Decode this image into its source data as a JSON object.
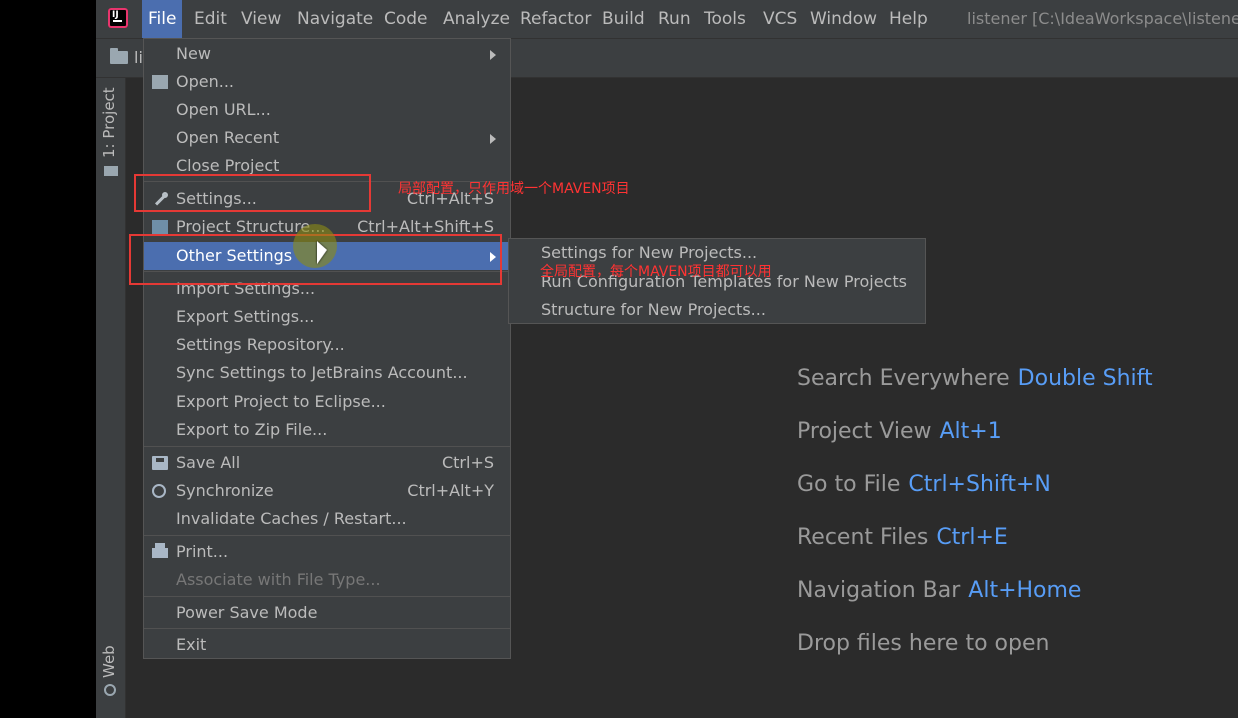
{
  "window_title": "listener [C:\\IdeaWorkspace\\listener",
  "menubar": {
    "items": [
      "File",
      "Edit",
      "View",
      "Navigate",
      "Code",
      "Analyze",
      "Refactor",
      "Build",
      "Run",
      "Tools",
      "VCS",
      "Window",
      "Help"
    ]
  },
  "navbar": {
    "label": "li"
  },
  "sidebar": {
    "project_tab": "1: Project",
    "web_tab": "Web"
  },
  "file_menu": {
    "items": [
      {
        "label": "New",
        "shortcut": "",
        "submenu": true,
        "icon": ""
      },
      {
        "label": "Open...",
        "shortcut": "",
        "submenu": false,
        "icon": "folder-open-icon"
      },
      {
        "label": "Open URL...",
        "shortcut": "",
        "submenu": false,
        "icon": ""
      },
      {
        "label": "Open Recent",
        "shortcut": "",
        "submenu": true,
        "icon": ""
      },
      {
        "label": "Close Project",
        "shortcut": "",
        "submenu": false,
        "icon": ""
      },
      {
        "label": "Settings...",
        "shortcut": "Ctrl+Alt+S",
        "submenu": false,
        "icon": "wrench-icon"
      },
      {
        "label": "Project Structure...",
        "shortcut": "Ctrl+Alt+Shift+S",
        "submenu": false,
        "icon": "project-structure-icon"
      },
      {
        "label": "Other Settings",
        "shortcut": "",
        "submenu": true,
        "icon": "",
        "highlighted": true
      },
      {
        "label": "Import Settings...",
        "shortcut": "",
        "submenu": false,
        "icon": ""
      },
      {
        "label": "Export Settings...",
        "shortcut": "",
        "submenu": false,
        "icon": ""
      },
      {
        "label": "Settings Repository...",
        "shortcut": "",
        "submenu": false,
        "icon": ""
      },
      {
        "label": "Sync Settings to JetBrains Account...",
        "shortcut": "",
        "submenu": false,
        "icon": ""
      },
      {
        "label": "Export Project to Eclipse...",
        "shortcut": "",
        "submenu": false,
        "icon": ""
      },
      {
        "label": "Export to Zip File...",
        "shortcut": "",
        "submenu": false,
        "icon": ""
      },
      {
        "label": "Save All",
        "shortcut": "Ctrl+S",
        "submenu": false,
        "icon": "save-icon"
      },
      {
        "label": "Synchronize",
        "shortcut": "Ctrl+Alt+Y",
        "submenu": false,
        "icon": "sync-icon"
      },
      {
        "label": "Invalidate Caches / Restart...",
        "shortcut": "",
        "submenu": false,
        "icon": ""
      },
      {
        "label": "Print...",
        "shortcut": "",
        "submenu": false,
        "icon": "print-icon"
      },
      {
        "label": "Associate with File Type...",
        "shortcut": "",
        "submenu": false,
        "icon": "",
        "disabled": true
      },
      {
        "label": "Power Save Mode",
        "shortcut": "",
        "submenu": false,
        "icon": ""
      },
      {
        "label": "Exit",
        "shortcut": "",
        "submenu": false,
        "icon": ""
      }
    ]
  },
  "other_settings_submenu": {
    "items": [
      "Settings for New Projects...",
      "Run Configuration Templates for New Projects",
      "Structure for New Projects..."
    ]
  },
  "annotations": {
    "local": "局部配置，只作用域一个MAVEN项目",
    "global": "全局配置，每个MAVEN项目都可以用"
  },
  "welcome": {
    "hints": [
      {
        "label": "Search Everywhere",
        "key": "Double Shift"
      },
      {
        "label": "Project View",
        "key": "Alt+1"
      },
      {
        "label": "Go to File",
        "key": "Ctrl+Shift+N"
      },
      {
        "label": "Recent Files",
        "key": "Ctrl+E"
      },
      {
        "label": "Navigation Bar",
        "key": "Alt+Home"
      },
      {
        "label": "Drop files here to open",
        "key": ""
      }
    ]
  },
  "colors": {
    "accent": "#4b6eaf",
    "link": "#589df6",
    "annotation": "#e53935"
  }
}
